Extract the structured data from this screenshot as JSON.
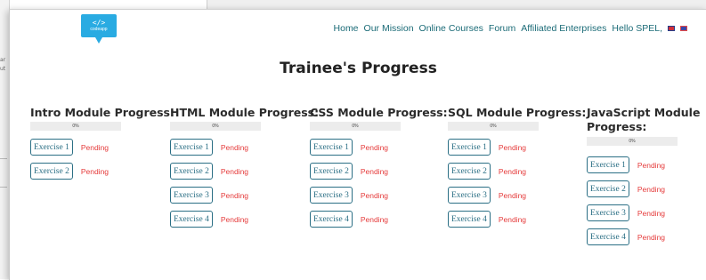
{
  "background": {
    "fragments": [
      "ar",
      "ut"
    ]
  },
  "brand": {
    "logo_mark": "</>",
    "logo_text": "codeapp",
    "color": "#29abe2"
  },
  "nav": {
    "items": [
      "Home",
      "Our Mission",
      "Online Courses",
      "Forum",
      "Affiliated Enterprises",
      "Hello SPEL,"
    ],
    "flags": [
      "uk-flag-icon",
      "other-flag-icon"
    ],
    "link_color": "#1b6b77"
  },
  "page": {
    "title": "Trainee's Progress"
  },
  "modules": [
    {
      "title": "Intro Module Progress:",
      "progress_label": "0%",
      "progress": 0,
      "exercises": [
        {
          "label": "Exercise 1",
          "status": "Pending"
        },
        {
          "label": "Exercise 2",
          "status": "Pending"
        }
      ]
    },
    {
      "title": "HTML Module Progress:",
      "progress_label": "0%",
      "progress": 0,
      "exercises": [
        {
          "label": "Exercise 1",
          "status": "Pending"
        },
        {
          "label": "Exercise 2",
          "status": "Pending"
        },
        {
          "label": "Exercise 3",
          "status": "Pending"
        },
        {
          "label": "Exercise 4",
          "status": "Pending"
        }
      ]
    },
    {
      "title": "CSS Module Progress:",
      "progress_label": "0%",
      "progress": 0,
      "exercises": [
        {
          "label": "Exercise 1",
          "status": "Pending"
        },
        {
          "label": "Exercise 2",
          "status": "Pending"
        },
        {
          "label": "Exercise 3",
          "status": "Pending"
        },
        {
          "label": "Exercise 4",
          "status": "Pending"
        }
      ]
    },
    {
      "title": "SQL Module Progress:",
      "progress_label": "0%",
      "progress": 0,
      "exercises": [
        {
          "label": "Exercise 1",
          "status": "Pending"
        },
        {
          "label": "Exercise 2",
          "status": "Pending"
        },
        {
          "label": "Exercise 3",
          "status": "Pending"
        },
        {
          "label": "Exercise 4",
          "status": "Pending"
        }
      ]
    },
    {
      "title_line1": "JavaScript Module",
      "title_line2": "Progress:",
      "progress_label": "0%",
      "progress": 0,
      "exercises": [
        {
          "label": "Exercise 1",
          "status": "Pending"
        },
        {
          "label": "Exercise 2",
          "status": "Pending"
        },
        {
          "label": "Exercise 3",
          "status": "Pending"
        },
        {
          "label": "Exercise 4",
          "status": "Pending"
        }
      ]
    }
  ],
  "colors": {
    "pending": "#e53b3b",
    "button_border": "#2b6f85"
  }
}
